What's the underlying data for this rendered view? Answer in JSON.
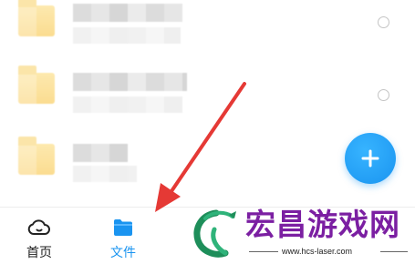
{
  "bottom_nav": {
    "items": [
      {
        "label": "首页",
        "icon": "cloud-icon",
        "active": false
      },
      {
        "label": "文件",
        "icon": "folder-icon",
        "active": true
      }
    ]
  },
  "fab": {
    "icon": "plus-icon"
  },
  "watermark": {
    "title": "宏昌游戏网",
    "url": "www.hcs-laser.com"
  },
  "colors": {
    "accent": "#1a94f0",
    "arrow": "#e53935",
    "watermark_text": "#7b1fa2"
  }
}
